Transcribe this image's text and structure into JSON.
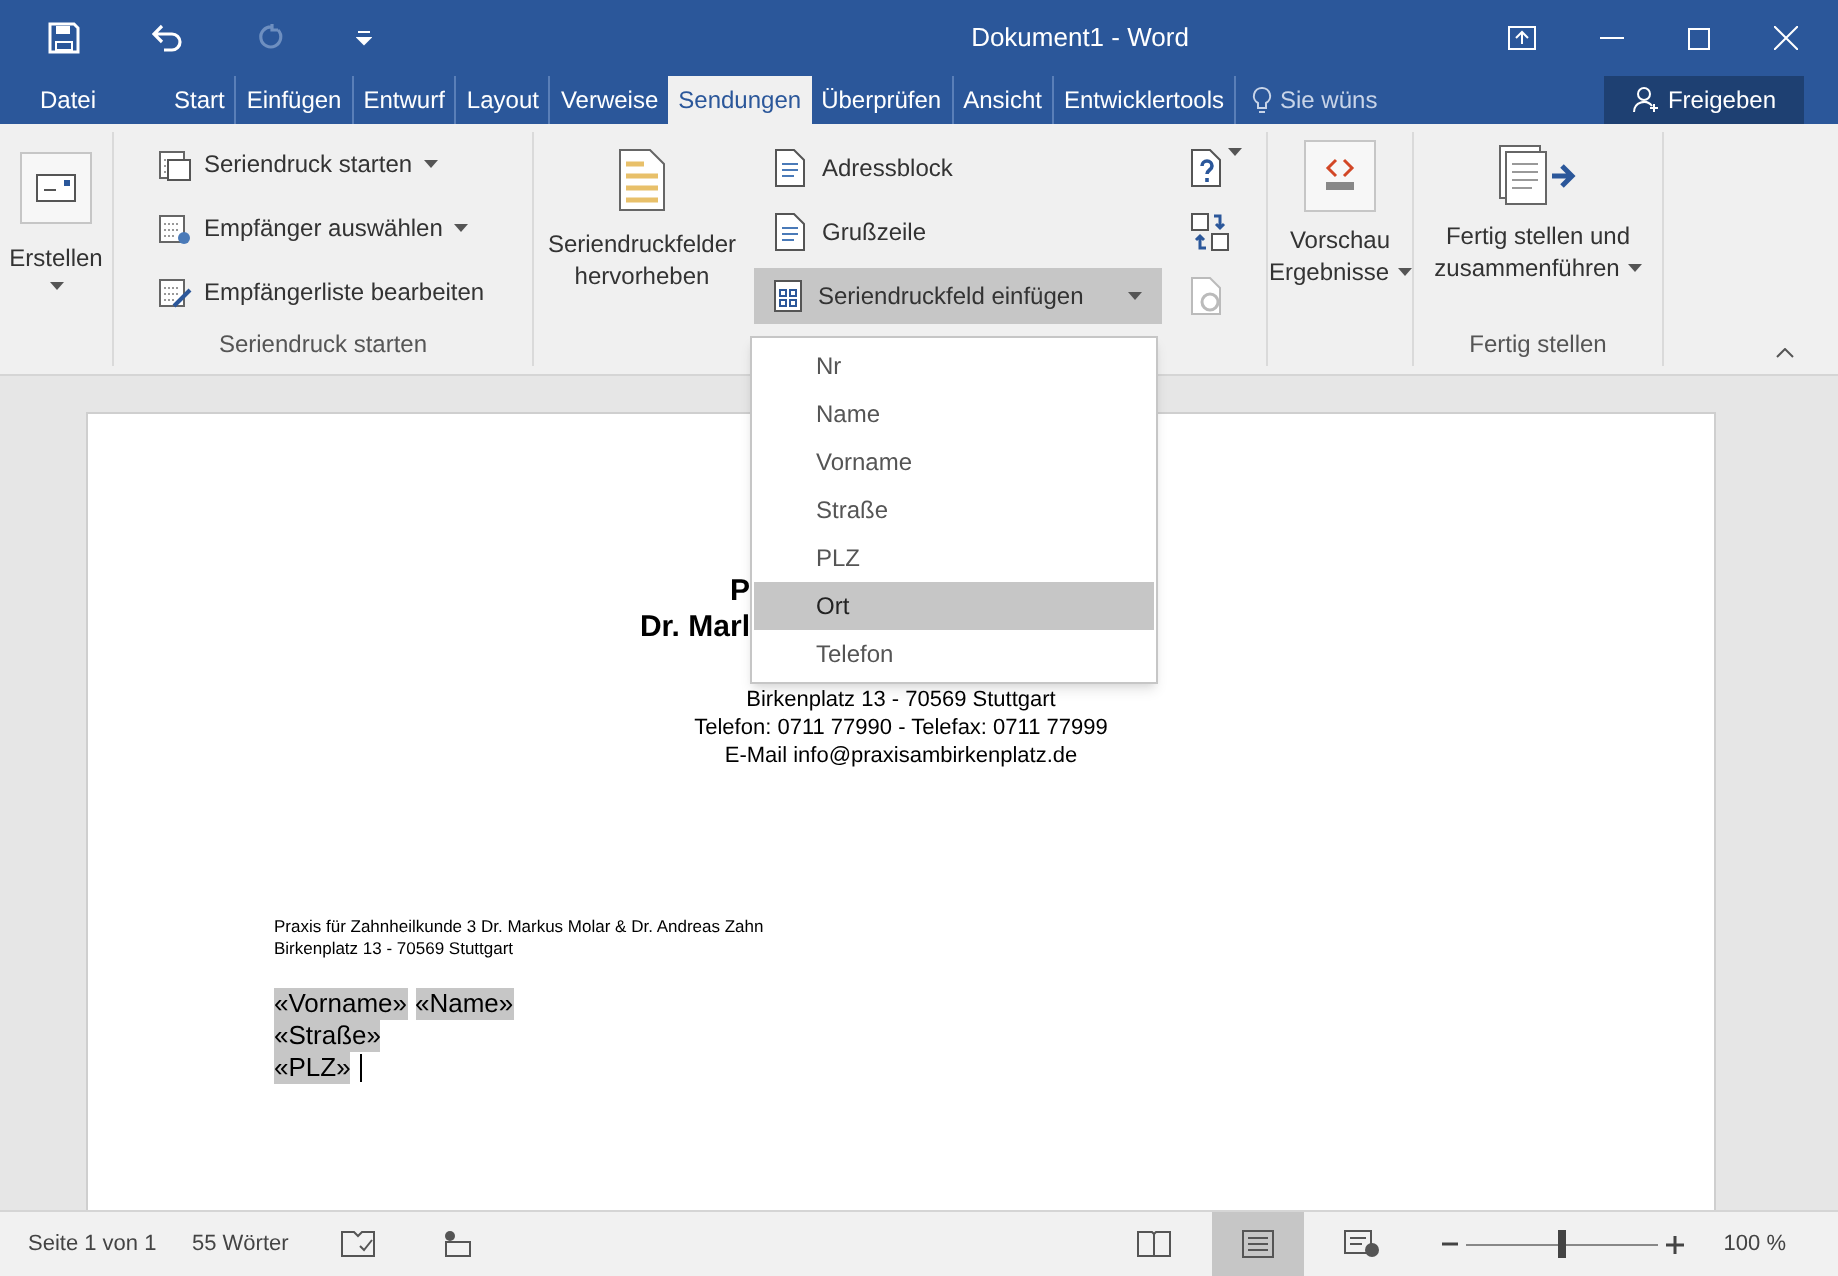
{
  "window": {
    "title": "Dokument1 - Word"
  },
  "tabs": [
    {
      "label": "Datei",
      "selected": false
    },
    {
      "label": "Start",
      "selected": false
    },
    {
      "label": "Einfügen",
      "selected": false
    },
    {
      "label": "Entwurf",
      "selected": false
    },
    {
      "label": "Layout",
      "selected": false
    },
    {
      "label": "Verweise",
      "selected": false
    },
    {
      "label": "Sendungen",
      "selected": true
    },
    {
      "label": "Überprüfen",
      "selected": false
    },
    {
      "label": "Ansicht",
      "selected": false
    },
    {
      "label": "Entwicklertools",
      "selected": false
    }
  ],
  "tell_me": {
    "placeholder": "Sie wüns"
  },
  "share_button": "Freigeben",
  "ribbon": {
    "create": {
      "label": "Erstellen"
    },
    "start_group": {
      "title": "Seriendruck starten",
      "items": [
        "Seriendruck starten",
        "Empfänger auswählen",
        "Empfängerliste bearbeiten"
      ]
    },
    "fields_group": {
      "highlight": "Seriendruckfelder hervorheben",
      "items": [
        "Adressblock",
        "Grußzeile"
      ],
      "insert_field": {
        "label": "Seriendruckfeld einfügen",
        "expanded": true
      }
    },
    "preview": {
      "label_1": "Vorschau",
      "label_2": "Ergebnisse"
    },
    "finish_group": {
      "title": "Fertig stellen",
      "label_1": "Fertig stellen und",
      "label_2": "zusammenführen"
    }
  },
  "field_menu": [
    {
      "label": "Nr",
      "selected": false
    },
    {
      "label": "Name",
      "selected": false
    },
    {
      "label": "Vorname",
      "selected": false
    },
    {
      "label": "Straße",
      "selected": false
    },
    {
      "label": "PLZ",
      "selected": false
    },
    {
      "label": "Ort",
      "selected": true
    },
    {
      "label": "Telefon",
      "selected": false
    }
  ],
  "document": {
    "letterhead_partial": [
      "P",
      "Dr. Marl"
    ],
    "letterhead": [
      "Birkenplatz 13 - 70569 Stuttgart",
      "Telefon: 0711 77990 - Telefax: 0711 77999",
      "E-Mail info@praxisambirkenplatz.de"
    ],
    "sender": [
      "Praxis für Zahnheilkunde 3 Dr. Markus Molar & Dr. Andreas Zahn",
      "Birkenplatz 13 - 70569 Stuttgart"
    ],
    "address": [
      [
        "«Vorname»",
        "«Name»"
      ],
      [
        "«Straße»"
      ],
      [
        "«PLZ»"
      ]
    ]
  },
  "status_bar": {
    "page": "Seite 1 von 1",
    "words": "55 Wörter",
    "views": [
      {
        "kind": "read",
        "selected": false
      },
      {
        "kind": "print",
        "selected": true
      },
      {
        "kind": "web",
        "selected": false
      }
    ],
    "zoom": {
      "level": 0.5,
      "reading": "100 %"
    }
  }
}
